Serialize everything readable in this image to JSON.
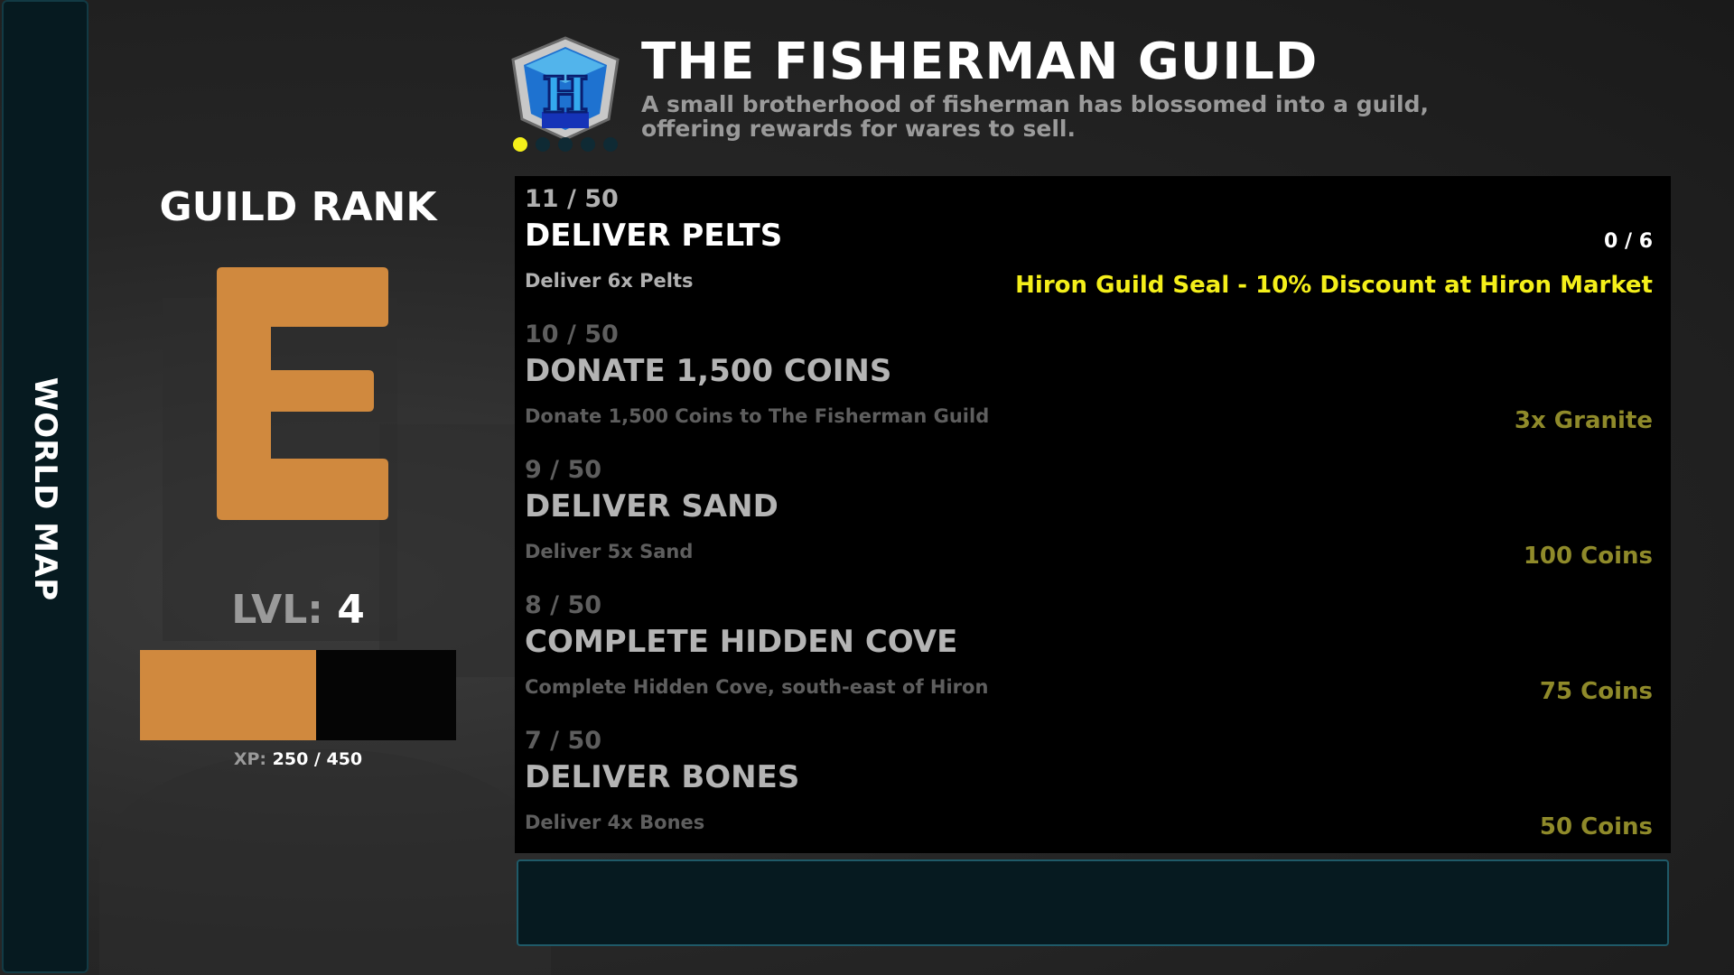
{
  "side_tab": {
    "label": "WORLD MAP"
  },
  "header": {
    "title": "THE FISHERMAN GUILD",
    "subtitle": "A small brotherhood of fisherman has blossomed into a guild, offering rewards for wares to sell.",
    "emblem_letter": "H",
    "emblem_dots": {
      "total": 5,
      "filled": 1
    }
  },
  "rank": {
    "title": "GUILD RANK",
    "letter": "E",
    "level_label": "LVL:",
    "level_value": "4",
    "xp_label": "XP:",
    "xp_value": "250 / 450",
    "xp_fraction": 0.556
  },
  "quests": [
    {
      "number": "11 / 50",
      "title": "DELIVER PELTS",
      "description": "Deliver 6x Pelts",
      "progress": "0 / 6",
      "reward": "Hiron Guild Seal - 10% Discount at Hiron Market",
      "state": "active"
    },
    {
      "number": "10 / 50",
      "title": "DONATE 1,500 COINS",
      "description": "Donate 1,500 Coins to The Fisherman Guild",
      "progress": "",
      "reward": "3x Granite",
      "state": "locked"
    },
    {
      "number": "9 / 50",
      "title": "DELIVER SAND",
      "description": "Deliver 5x Sand",
      "progress": "",
      "reward": "100 Coins",
      "state": "locked"
    },
    {
      "number": "8 / 50",
      "title": "COMPLETE HIDDEN COVE",
      "description": "Complete Hidden Cove, south-east of Hiron",
      "progress": "",
      "reward": "75 Coins",
      "state": "locked"
    },
    {
      "number": "7 / 50",
      "title": "DELIVER BONES",
      "description": "Deliver 4x Bones",
      "progress": "",
      "reward": "50 Coins",
      "state": "locked"
    }
  ],
  "colors": {
    "rank_accent": "#d0893e",
    "reward_active": "#f4ef1a",
    "reward_locked": "#8f8a2a",
    "panel_dark": "#061a20"
  }
}
